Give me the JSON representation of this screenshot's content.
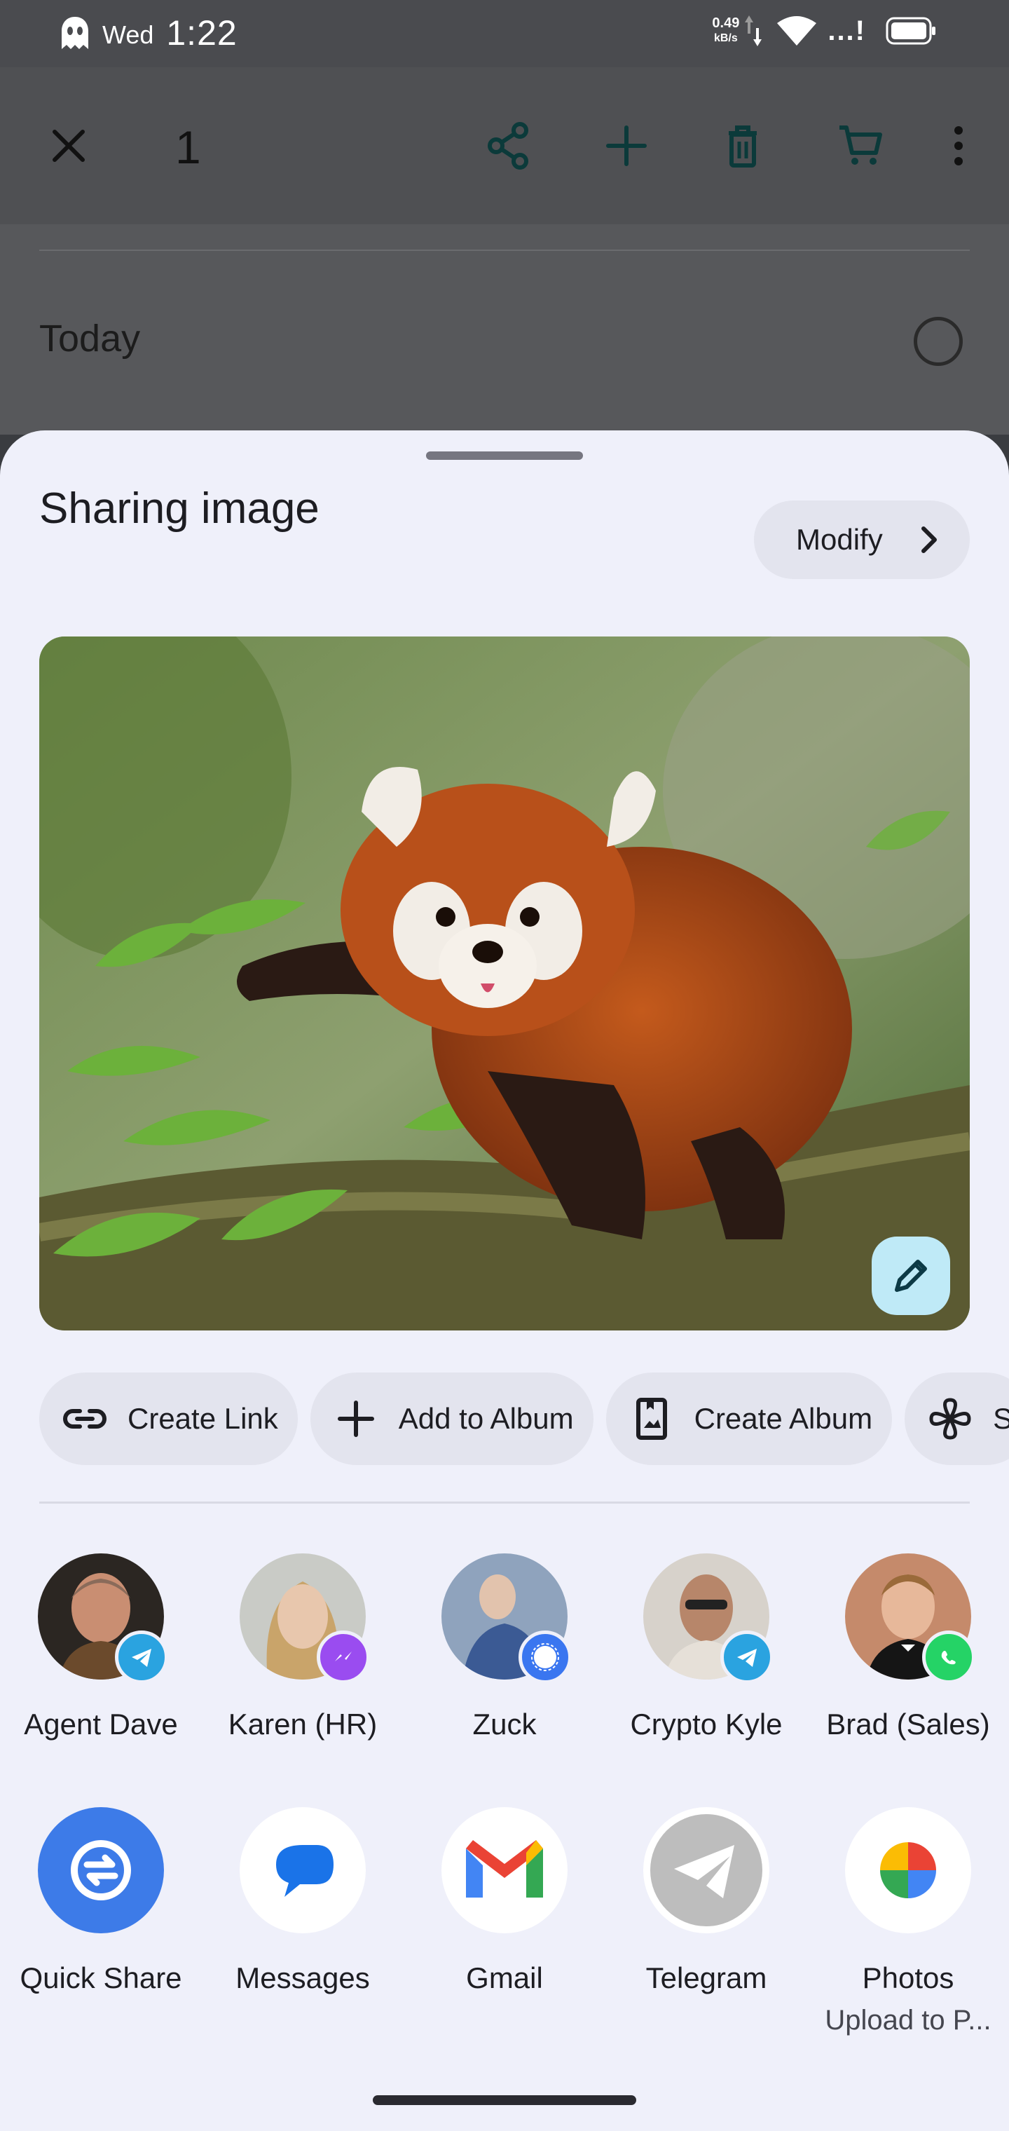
{
  "status_bar": {
    "day": "Wed",
    "time": "1:22",
    "net_rate_value": "0.49",
    "net_rate_unit": "kB/s",
    "signal_text": "...!"
  },
  "toolbar": {
    "selected_count": "1",
    "icons": [
      "close-icon",
      "share-icon",
      "add-icon",
      "delete-icon",
      "cart-icon",
      "more-vert-icon"
    ]
  },
  "background": {
    "section_label": "Today"
  },
  "share_sheet": {
    "title": "Sharing image",
    "modify_label": "Modify",
    "preview_alt": "red panda",
    "actions": [
      {
        "label": "Create Link",
        "icon": "link-icon"
      },
      {
        "label": "Add to Album",
        "icon": "plus-icon"
      },
      {
        "label": "Create Album",
        "icon": "album-icon"
      },
      {
        "label": "S",
        "icon": "pinwheel-icon"
      }
    ],
    "contacts": [
      {
        "name": "Agent Dave",
        "app": "telegram-badge-icon"
      },
      {
        "name": "Karen (HR)",
        "app": "messenger-badge-icon"
      },
      {
        "name": "Zuck",
        "app": "signal-badge-icon"
      },
      {
        "name": "Crypto Kyle",
        "app": "telegram-badge-icon"
      },
      {
        "name": "Brad (Sales)",
        "app": "whatsapp-badge-icon"
      }
    ],
    "apps": [
      {
        "name": "Quick Share",
        "sub": ""
      },
      {
        "name": "Messages",
        "sub": ""
      },
      {
        "name": "Gmail",
        "sub": ""
      },
      {
        "name": "Telegram",
        "sub": ""
      },
      {
        "name": "Photos",
        "sub": "Upload to P..."
      }
    ]
  },
  "colors": {
    "sheet_bg": "#eff0fa",
    "chip_bg": "#e3e4ee",
    "toolbar_icon": "#0b3a3a",
    "quick_share_blue": "#3d7be8",
    "edit_button": "#bfeaf7"
  }
}
